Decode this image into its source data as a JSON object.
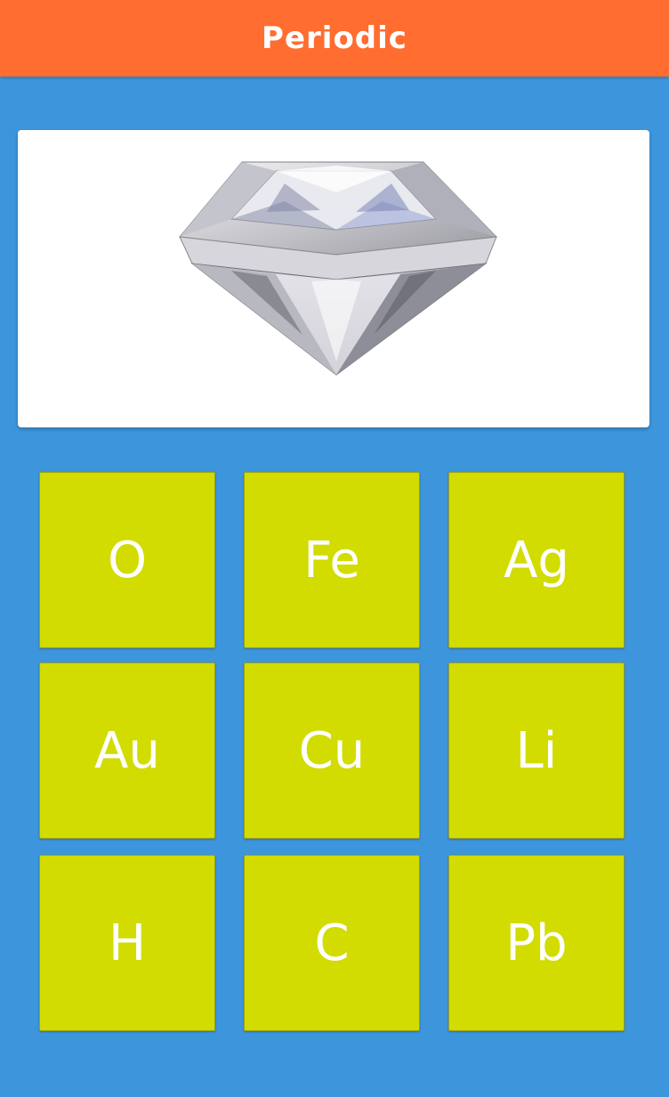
{
  "app_bar": {
    "title": "Periodic"
  },
  "question": {
    "image_icon": "diamond-icon"
  },
  "answers": [
    {
      "symbol": "O"
    },
    {
      "symbol": "Fe"
    },
    {
      "symbol": "Ag"
    },
    {
      "symbol": "Au"
    },
    {
      "symbol": "Cu"
    },
    {
      "symbol": "Li"
    },
    {
      "symbol": "H"
    },
    {
      "symbol": "C"
    },
    {
      "symbol": "Pb"
    }
  ],
  "colors": {
    "app_bar": "#ff6d30",
    "background": "#3d96dc",
    "tile": "#d2dc00",
    "tile_text": "#ffffff",
    "card": "#ffffff"
  }
}
